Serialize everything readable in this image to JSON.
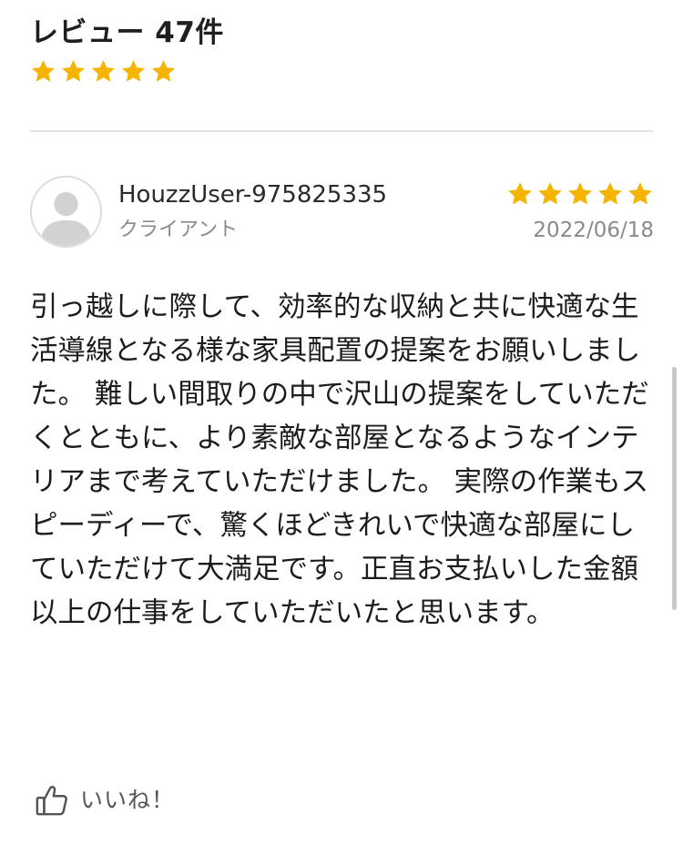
{
  "header": {
    "title": "レビュー 47件",
    "rating": 5,
    "max_rating": 5
  },
  "review": {
    "username": "HouzzUser-975825335",
    "role": "クライアント",
    "date": "2022/06/18",
    "rating": 5,
    "max_rating": 5,
    "text": "引っ越しに際して、効率的な収納と共に快適な生活導線となる様な家具配置の提案をお願いしました。 難しい間取りの中で沢山の提案をしていただくとともに、より素敵な部屋となるようなインテリアまで考えていただけました。 実際の作業もスピーディーで、驚くほどきれいで快適な部屋にしていただけて大満足です。正直お支払いした金額以上の仕事をしていただいたと思います。",
    "avatar_icon": "user-silhouette-icon"
  },
  "like": {
    "label": "いいね！",
    "icon": "thumbs-up-icon"
  },
  "colors": {
    "star": "#F5B400",
    "divider": "#E3E3E3",
    "secondary_text": "#8A8A8A",
    "primary_text": "#1C1C1C"
  }
}
